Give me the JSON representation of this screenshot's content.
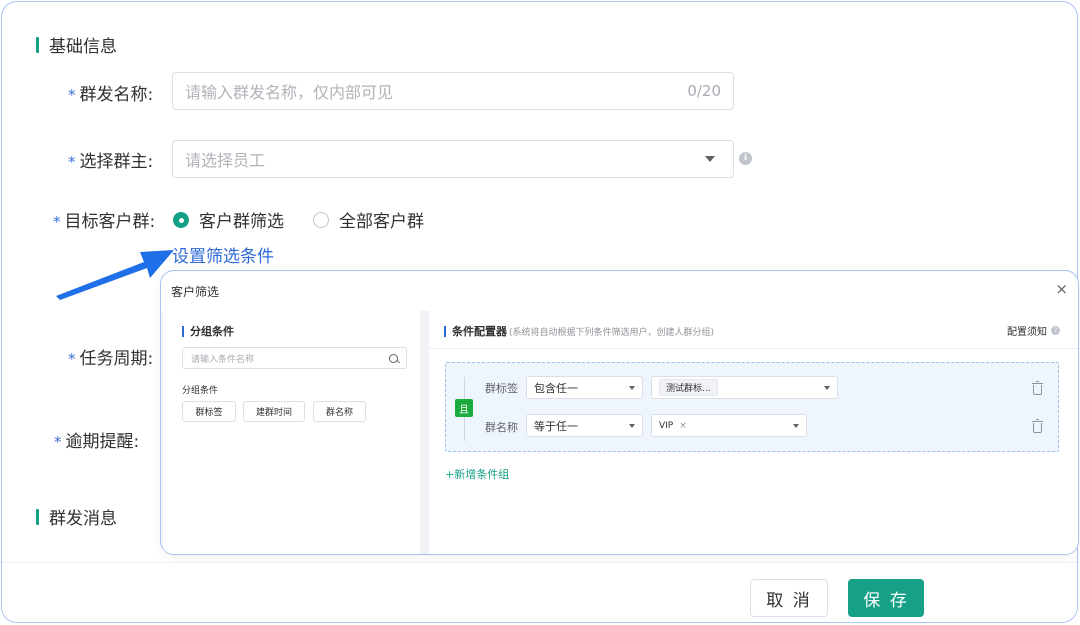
{
  "form": {
    "section_basic": "基础信息",
    "name_label": "群发名称:",
    "name_placeholder": "请输入群发名称，仅内部可见",
    "name_count": "0/20",
    "owner_label": "选择群主:",
    "owner_placeholder": "请选择员工",
    "target_label": "目标客户群:",
    "target_options": [
      "客户群筛选",
      "全部客户群"
    ],
    "target_selected": "客户群筛选",
    "filter_link": "设置筛选条件",
    "period_label": "任务周期:",
    "overdue_label": "逾期提醒:",
    "section_message": "群发消息",
    "required_mark": "*",
    "info_glyph": "i"
  },
  "footer": {
    "cancel_label": "取 消",
    "save_label": "保 存"
  },
  "dialog": {
    "title": "客户筛选",
    "close_glyph": "×",
    "left": {
      "title": "分组条件",
      "search_placeholder": "请输入条件名称",
      "group_caption": "分组条件",
      "chips": [
        "群标签",
        "建群时间",
        "群名称"
      ]
    },
    "right": {
      "title": "条件配置器",
      "subtitle": "(系统将自动根据下列条件筛选用户，创建人群分组)",
      "notice": "配置须知",
      "notice_glyph": "?",
      "and_label": "且",
      "conditions": [
        {
          "field": "群标签",
          "operator": "包含任一",
          "value": "测试群标..."
        },
        {
          "field": "群名称",
          "operator": "等于任一",
          "value": "VIP"
        }
      ],
      "remove_glyph": "×",
      "add_group": "+新增条件组"
    }
  },
  "colors": {
    "primary": "#16a085",
    "link": "#2f6ad8",
    "and_tag": "#1aad3e"
  }
}
